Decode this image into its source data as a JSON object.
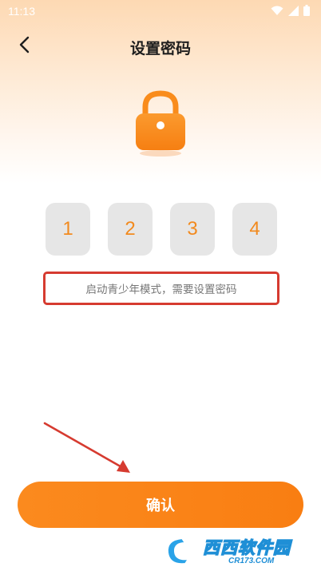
{
  "status_bar": {
    "time": "11:13",
    "icons": [
      "wifi-icon",
      "signal-icon",
      "battery-icon"
    ]
  },
  "nav": {
    "back_icon": "chevron-left-icon",
    "title": "设置密码"
  },
  "lock": {
    "icon": "lock-icon",
    "color": "#f98c1c"
  },
  "pin": {
    "digits": [
      "1",
      "2",
      "3",
      "4"
    ]
  },
  "hint": {
    "text": "启动青少年模式，需要设置密码"
  },
  "actions": {
    "confirm_label": "确认"
  },
  "watermark": {
    "text": "西西软件园",
    "url_text": "CR173.COM"
  },
  "colors": {
    "accent": "#f98c1c",
    "digit": "#f28a1e",
    "pin_box": "#e6e6e6",
    "annotation_red": "#d63b30"
  }
}
